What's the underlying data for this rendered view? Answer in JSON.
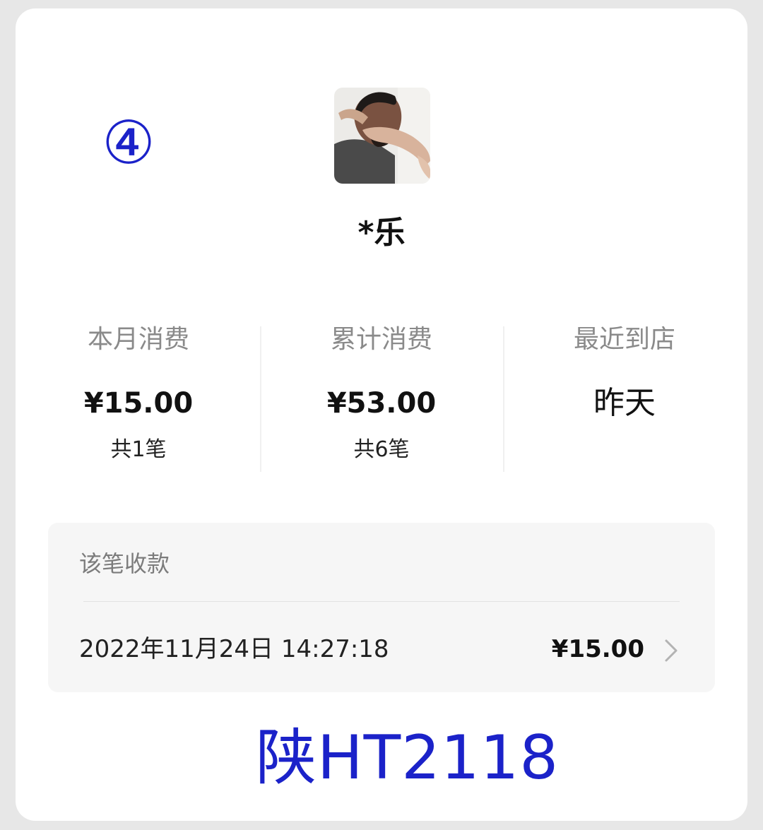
{
  "annotation": {
    "marker": "④",
    "plate": "陕HT2118",
    "color": "#1b22c9"
  },
  "customer": {
    "avatar_icon": "customer-avatar-photo",
    "name": "*乐"
  },
  "stats": [
    {
      "label": "本月消费",
      "value": "¥15.00",
      "sub": "共1笔"
    },
    {
      "label": "累计消费",
      "value": "¥53.00",
      "sub": "共6笔"
    },
    {
      "label": "最近到店",
      "value": "昨天"
    }
  ],
  "receipt": {
    "title": "该笔收款",
    "time": "2022年11月24日 14:27:18",
    "amount": "¥15.00",
    "chevron_icon": "chevron-right-icon"
  }
}
